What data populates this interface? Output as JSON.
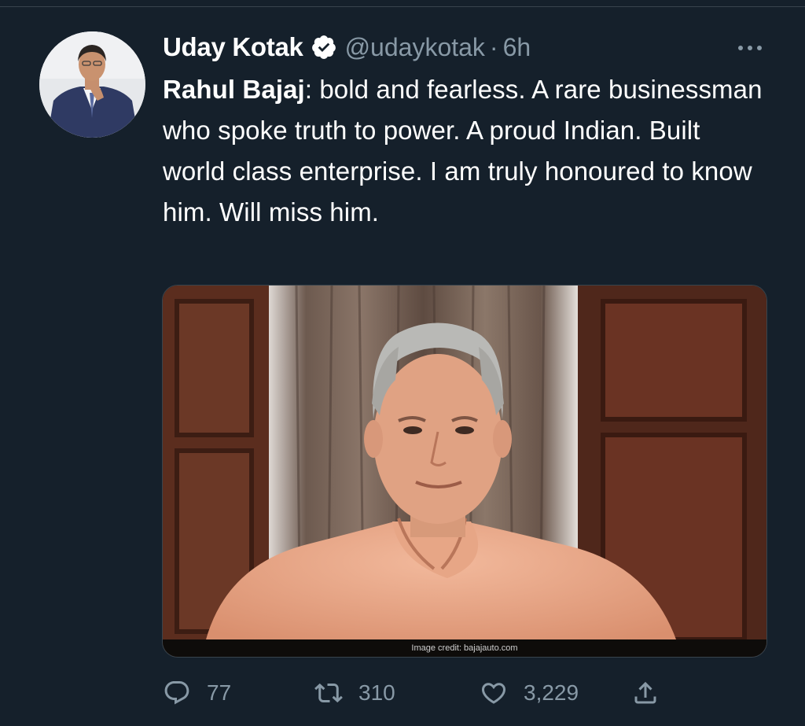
{
  "tweet": {
    "author_name": "Uday Kotak",
    "handle": "@udaykotak",
    "separator": "·",
    "time": "6h",
    "mention": "Rahul Bajaj",
    "body": ": bold and fearless. A rare businessman who spoke truth to power. A proud Indian. Built world class enterprise. I am truly honoured to know him. Will miss him.",
    "image_credit": "Image credit: bajajauto.com"
  },
  "actions": {
    "reply_count": "77",
    "retweet_count": "310",
    "like_count": "3,229"
  },
  "icons": {
    "verified": "verified-badge-icon",
    "more": "more-options-icon",
    "reply": "reply-icon",
    "retweet": "retweet-icon",
    "like": "heart-icon",
    "share": "share-icon"
  },
  "colors": {
    "background": "#15202b",
    "secondary_text": "#8899a6",
    "divider": "#38444d"
  }
}
